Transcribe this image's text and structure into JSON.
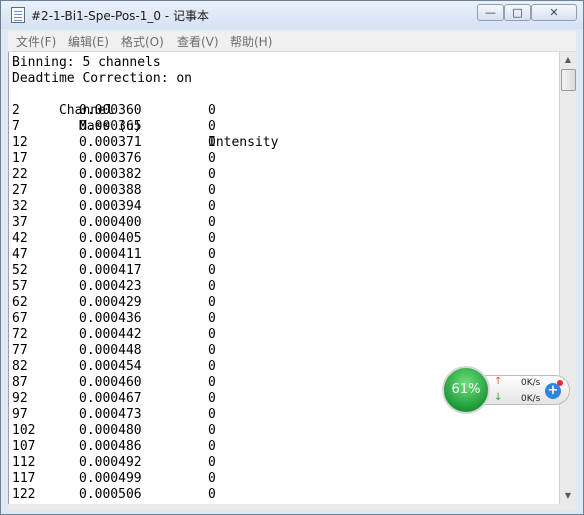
{
  "window": {
    "title": "#2-1-Bi1-Spe-Pos-1_0 - 记事本",
    "minimize_glyph": "—",
    "maximize_glyph": "□",
    "close_glyph": "✕"
  },
  "menu": [
    "文件(F)",
    "编辑(E)",
    "格式(O)",
    "查看(V)",
    "帮助(H)"
  ],
  "document": {
    "header_lines": [
      "Binning: 5 channels",
      "Deadtime Correction: on"
    ],
    "columns": [
      "Channel",
      "Mass (u)",
      "Intensity"
    ],
    "rows": [
      [
        "2",
        "0.000360",
        "0"
      ],
      [
        "7",
        "0.000365",
        "0"
      ],
      [
        "12",
        "0.000371",
        "0"
      ],
      [
        "17",
        "0.000376",
        "0"
      ],
      [
        "22",
        "0.000382",
        "0"
      ],
      [
        "27",
        "0.000388",
        "0"
      ],
      [
        "32",
        "0.000394",
        "0"
      ],
      [
        "37",
        "0.000400",
        "0"
      ],
      [
        "42",
        "0.000405",
        "0"
      ],
      [
        "47",
        "0.000411",
        "0"
      ],
      [
        "52",
        "0.000417",
        "0"
      ],
      [
        "57",
        "0.000423",
        "0"
      ],
      [
        "62",
        "0.000429",
        "0"
      ],
      [
        "67",
        "0.000436",
        "0"
      ],
      [
        "72",
        "0.000442",
        "0"
      ],
      [
        "77",
        "0.000448",
        "0"
      ],
      [
        "82",
        "0.000454",
        "0"
      ],
      [
        "87",
        "0.000460",
        "0"
      ],
      [
        "92",
        "0.000467",
        "0"
      ],
      [
        "97",
        "0.000473",
        "0"
      ],
      [
        "102",
        "0.000480",
        "0"
      ],
      [
        "107",
        "0.000486",
        "0"
      ],
      [
        "112",
        "0.000492",
        "0"
      ],
      [
        "117",
        "0.000499",
        "0"
      ],
      [
        "122",
        "0.000506",
        "0"
      ]
    ]
  },
  "speed_widget": {
    "percent": "61%",
    "upload": "0K/s",
    "download": "0K/s",
    "accent": "#1e9a3a"
  }
}
